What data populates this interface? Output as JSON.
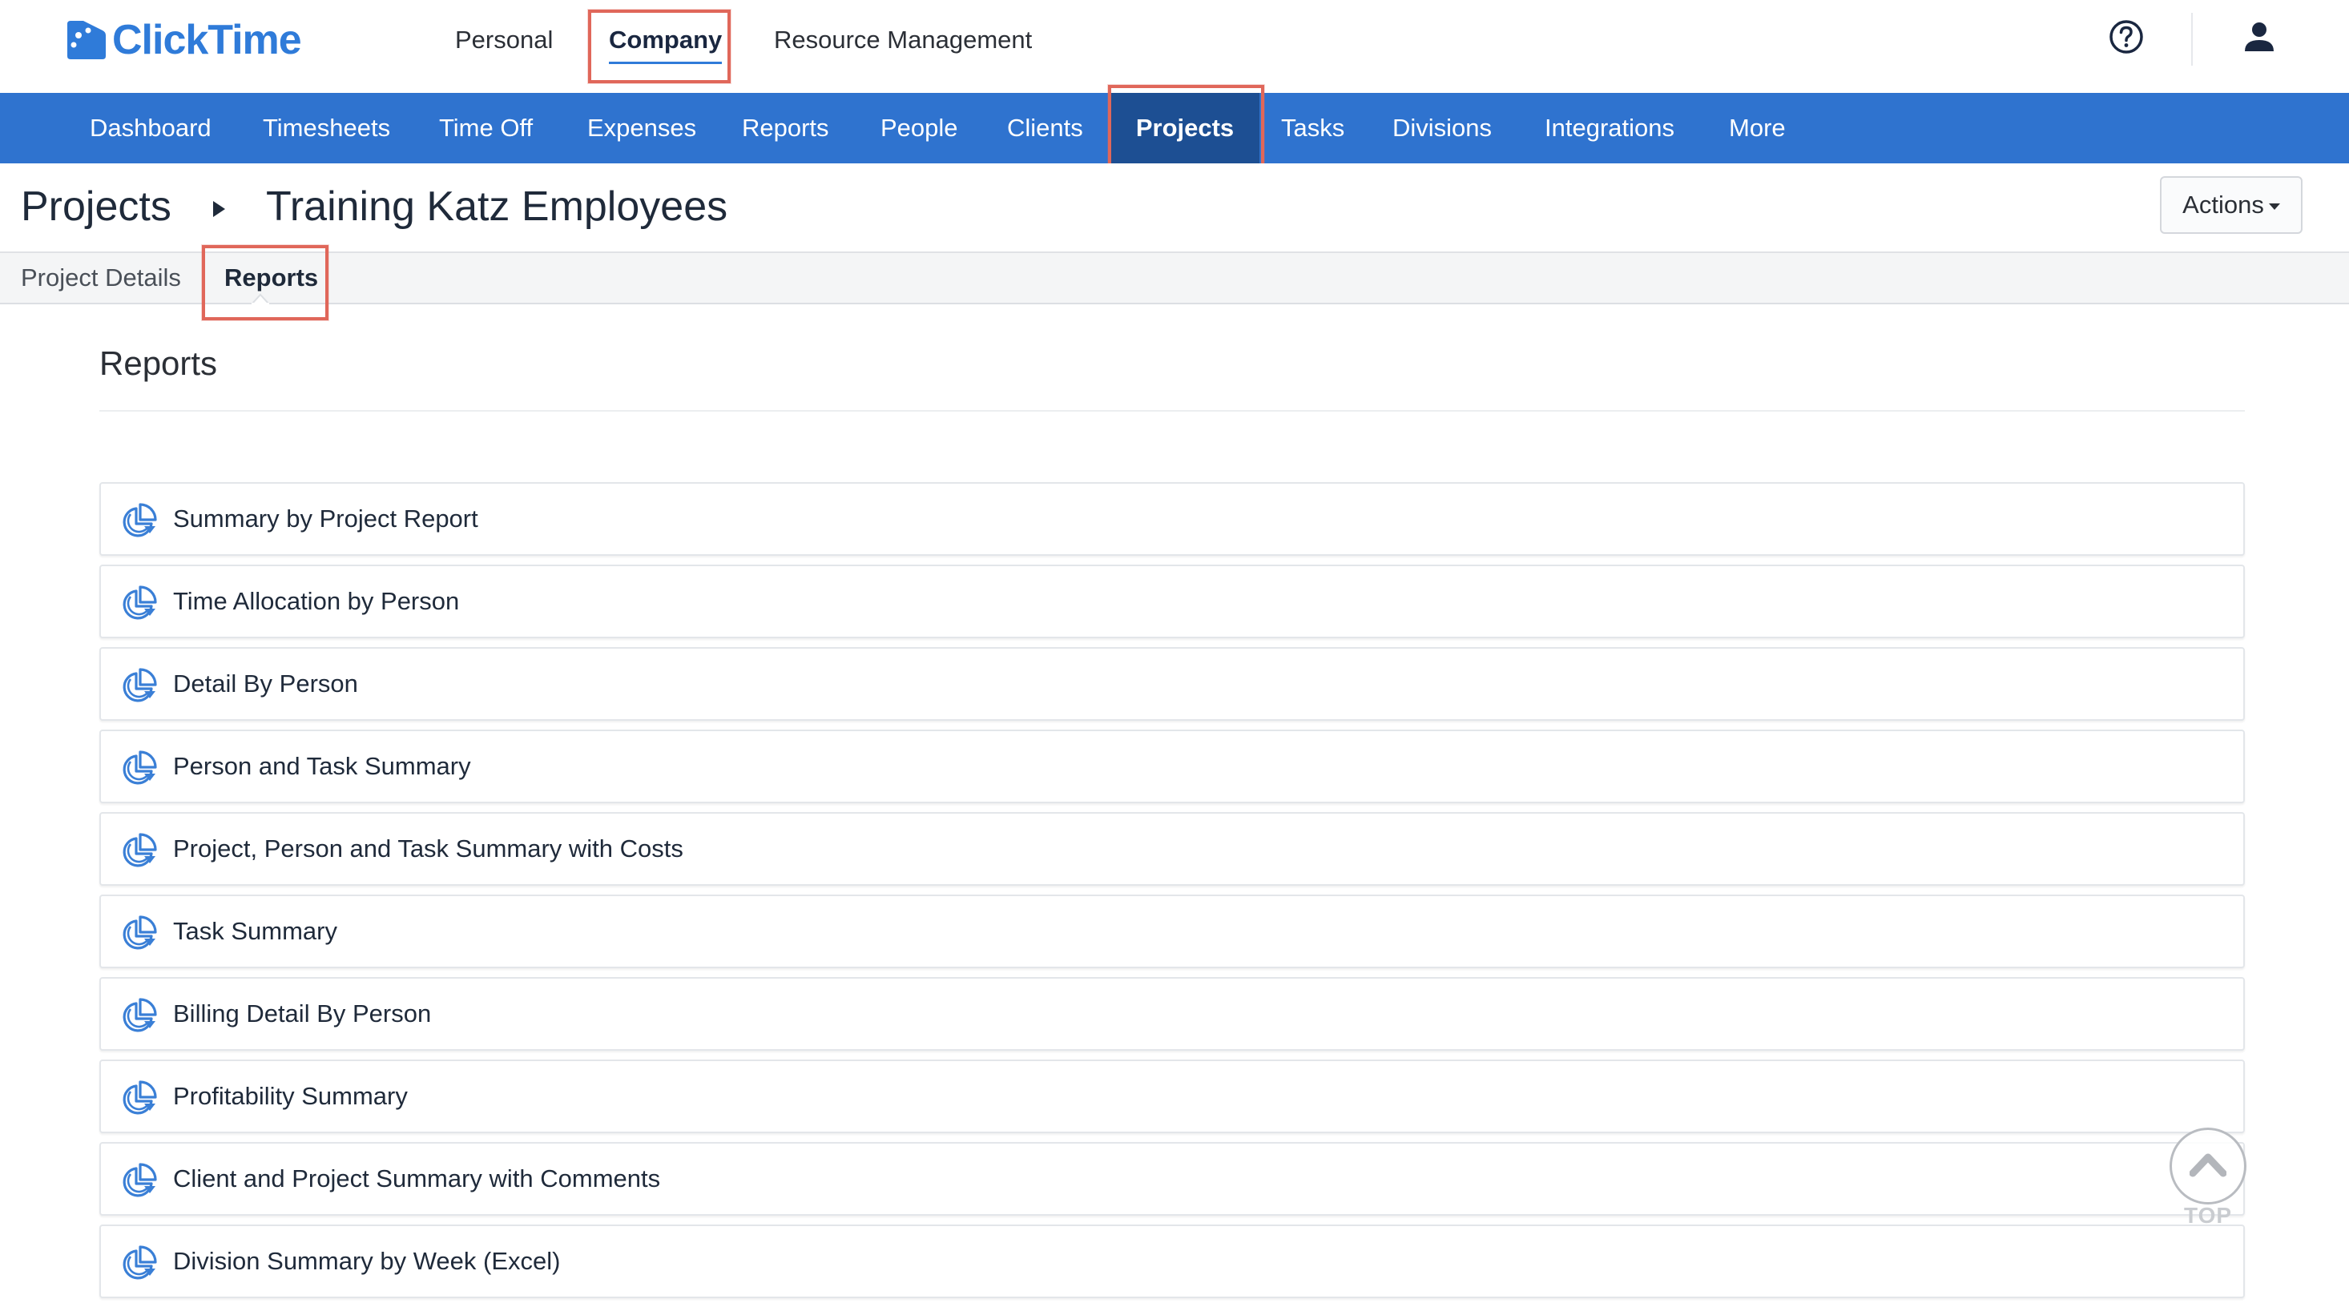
{
  "app": {
    "logo_text": "ClickTime",
    "brand_color": "#2f7bd9",
    "nav_color": "#2f73cf",
    "nav_active_color": "#1d4f93",
    "highlight_color": "#e0675a"
  },
  "top_nav": {
    "items": [
      "Personal",
      "Company",
      "Resource Management"
    ],
    "active": "Company"
  },
  "top_icons": {
    "help": "help-circle-icon",
    "user": "user-icon"
  },
  "main_nav": {
    "items": [
      "Dashboard",
      "Timesheets",
      "Time Off",
      "Expenses",
      "Reports",
      "People",
      "Clients",
      "Projects",
      "Tasks",
      "Divisions",
      "Integrations",
      "More"
    ],
    "active": "Projects"
  },
  "breadcrumb": {
    "root": "Projects",
    "current": "Training Katz Employees"
  },
  "actions_button": "Actions",
  "sub_tabs": {
    "items": [
      "Project Details",
      "Reports"
    ],
    "active": "Reports"
  },
  "section_title": "Reports",
  "reports": [
    "Summary by Project Report",
    "Time Allocation by Person",
    "Detail By Person",
    "Person and Task Summary",
    "Project, Person and Task Summary with Costs",
    "Task Summary",
    "Billing Detail By Person",
    "Profitability Summary",
    "Client and Project Summary with Comments",
    "Division Summary by Week (Excel)"
  ],
  "scroll_top_label": "TOP"
}
